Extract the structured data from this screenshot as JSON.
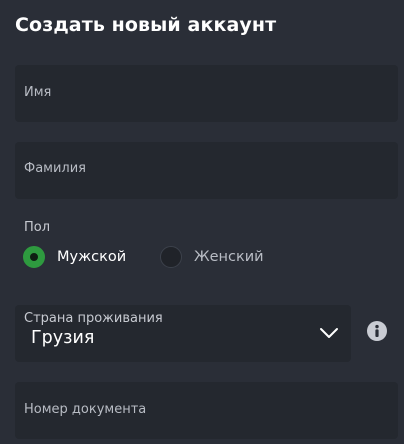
{
  "form": {
    "title": "Создать новый аккаунт",
    "first_name": {
      "placeholder": "Имя"
    },
    "last_name": {
      "placeholder": "Фамилия"
    },
    "gender": {
      "label": "Пол",
      "options": [
        {
          "label": "Мужской",
          "selected": true
        },
        {
          "label": "Женский",
          "selected": false
        }
      ]
    },
    "country": {
      "label": "Страна проживания",
      "value": "Грузия"
    },
    "document_number": {
      "placeholder": "Номер документа"
    }
  },
  "colors": {
    "background": "#2a2e37",
    "field_background": "#24282f",
    "accent_green": "#2e9a3f",
    "text_primary": "#ffffff",
    "text_muted": "#b8bcc4"
  },
  "icons": {
    "country_dropdown": "chevron-down-icon",
    "country_info": "info-icon"
  }
}
